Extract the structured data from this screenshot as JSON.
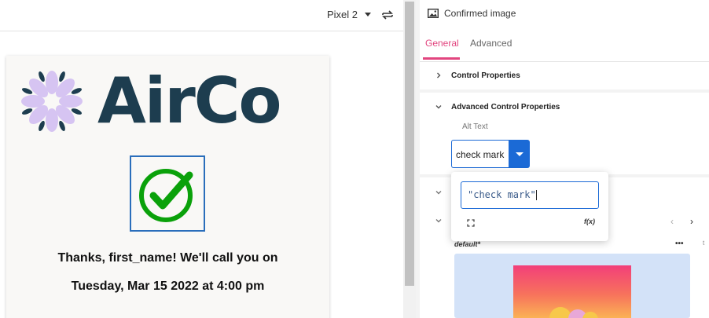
{
  "toolbar": {
    "device": "Pixel 2"
  },
  "preview": {
    "logo_text": "AirCo",
    "message_line1": "Thanks, first_name! We'll call you on",
    "message_line2": "Tuesday, Mar 15 2022 at 4:00 pm"
  },
  "panel": {
    "title": "Confirmed image",
    "tabs": [
      {
        "label": "General",
        "active": true
      },
      {
        "label": "Advanced",
        "active": false
      }
    ],
    "sections": {
      "control_properties": "Control Properties",
      "advanced_control_properties": "Advanced Control Properties"
    },
    "alt_text": {
      "label": "Alt Text",
      "value": "check mark"
    },
    "expression_popover": {
      "value": "\"check mark\"",
      "expand_icon": "expand-icon",
      "fx_label": "f(x)"
    },
    "styles": {
      "default_label": "default*",
      "more_label": "•••",
      "trailing_letter": "t"
    }
  },
  "colors": {
    "accent": "#e2457f",
    "primary_blue": "#1b6ad6",
    "logo_navy": "#1d3d4f",
    "check_green": "#0aa10a",
    "petal_lavender": "#d6c4f2"
  }
}
